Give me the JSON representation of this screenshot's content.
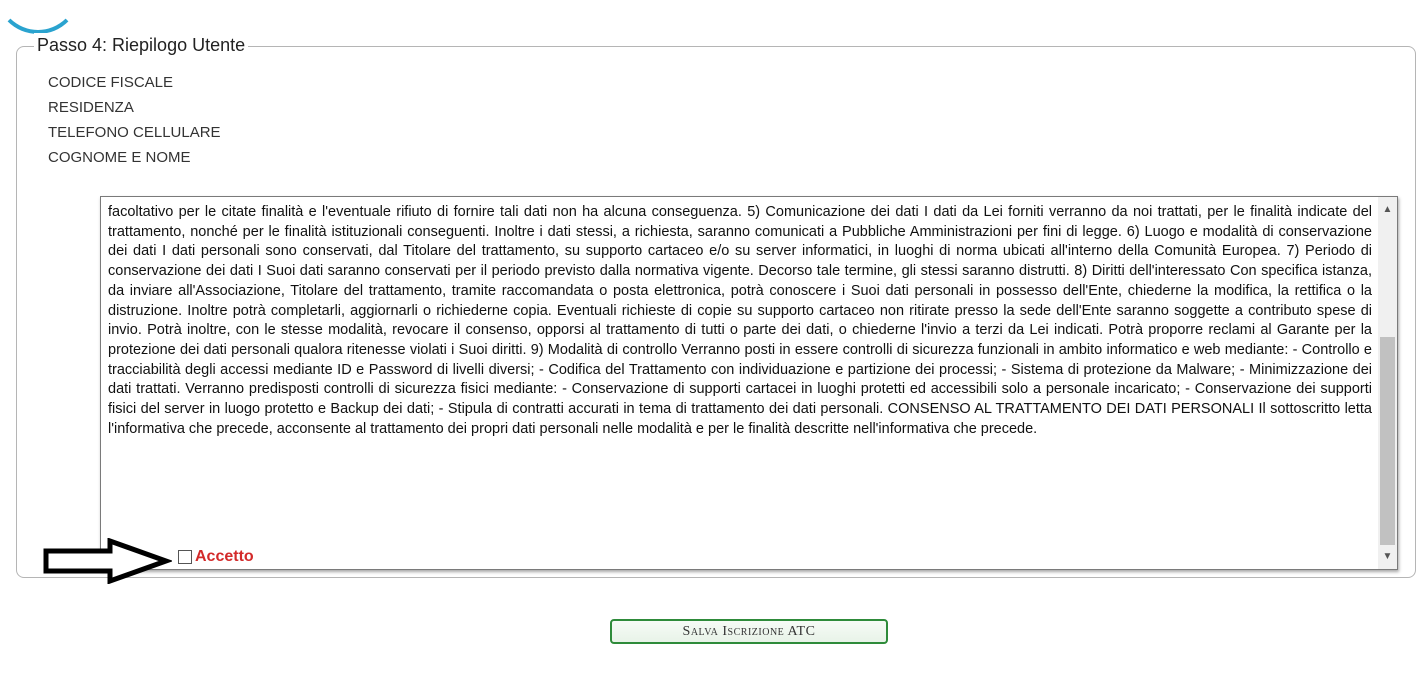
{
  "section": {
    "legend": "Passo 4: Riepilogo Utente",
    "fields": [
      {
        "label": "CODICE FISCALE"
      },
      {
        "label": "RESIDENZA"
      },
      {
        "label": "TELEFONO CELLULARE"
      },
      {
        "label": "COGNOME E NOME"
      }
    ]
  },
  "privacy": {
    "text": "facoltativo per le citate finalità e l'eventuale rifiuto di fornire tali dati non ha alcuna conseguenza. 5) Comunicazione dei dati I dati da Lei forniti verranno da noi trattati, per le finalità indicate del trattamento, nonché per le finalità istituzionali conseguenti. Inoltre i dati stessi, a richiesta, saranno comunicati a Pubbliche Amministrazioni per fini di legge. 6) Luogo e modalità di conservazione dei dati I dati personali sono conservati, dal Titolare del trattamento, su supporto cartaceo e/o su server informatici, in luoghi di norma ubicati all'interno della Comunità Europea. 7) Periodo di conservazione dei dati I Suoi dati saranno conservati per il periodo previsto dalla normativa vigente. Decorso tale termine, gli stessi saranno distrutti. 8) Diritti dell'interessato Con specifica istanza, da inviare all'Associazione, Titolare del trattamento, tramite raccomandata o posta elettronica, potrà conoscere i Suoi dati personali in possesso dell'Ente, chiederne la modifica, la rettifica o la distruzione. Inoltre potrà completarli, aggiornarli o richiederne copia. Eventuali richieste di copie su supporto cartaceo non ritirate presso la sede dell'Ente saranno soggette a contributo spese di invio. Potrà inoltre, con le stesse modalità, revocare il consenso, opporsi al trattamento di tutti o parte dei dati, o chiederne l'invio a terzi da Lei indicati. Potrà proporre reclami al Garante per la protezione dei dati personali qualora ritenesse violati i Suoi diritti. 9) Modalità di controllo Verranno posti in essere controlli di sicurezza funzionali in ambito informatico e web mediante: - Controllo e tracciabilità degli accessi mediante ID e Password di livelli diversi; - Codifica del Trattamento con individuazione e partizione dei processi; - Sistema di protezione da Malware; - Minimizzazione dei dati trattati. Verranno predisposti controlli di sicurezza fisici mediante: - Conservazione di supporti cartacei in luoghi protetti ed accessibili solo a personale incaricato; - Conservazione dei supporti fisici del server in luogo protetto e Backup dei dati; - Stipula di contratti accurati in tema di trattamento dei dati personali. CONSENSO AL TRATTAMENTO DEI DATI PERSONALI Il sottoscritto letta l'informativa che precede, acconsente al trattamento dei propri dati personali nelle modalità e per le finalità descritte nell'informativa che precede.",
    "accept_label": "Accetto",
    "accept_checked": false
  },
  "actions": {
    "save_label": "Salva Iscrizione ATC"
  },
  "colors": {
    "accept_label": "#d32a2a",
    "save_border": "#2e8b3a",
    "logo_arc": "#2aa3cf"
  },
  "icons": {
    "pointer": "arrow-right-icon"
  }
}
